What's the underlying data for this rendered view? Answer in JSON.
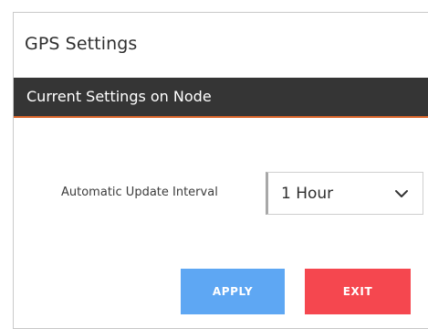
{
  "dialog": {
    "title": "GPS Settings"
  },
  "section": {
    "header": "Current Settings on Node"
  },
  "fields": {
    "update_interval": {
      "label": "Automatic Update Interval",
      "value": "1 Hour"
    }
  },
  "buttons": {
    "apply_label": "APPLY",
    "exit_label": "EXIT"
  },
  "colors": {
    "header_bg": "#353535",
    "header_accent": "#d9652b",
    "apply": "#5ea7f3",
    "exit": "#f5474f"
  }
}
